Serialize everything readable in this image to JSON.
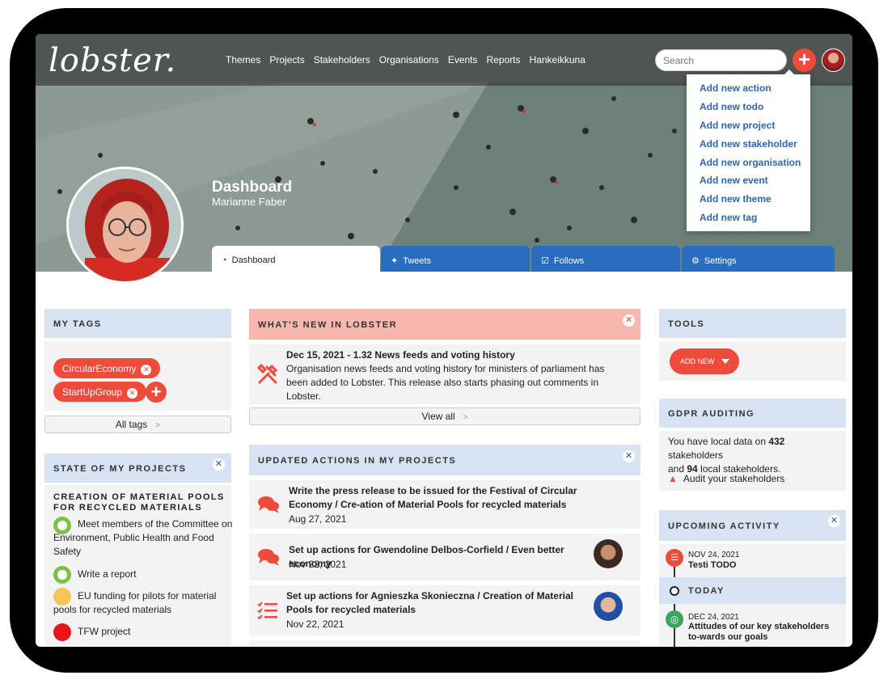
{
  "app": {
    "logo": "lobster."
  },
  "nav": [
    "Themes",
    "Projects",
    "Stakeholders",
    "Organisations",
    "Events",
    "Reports",
    "Hankeikkuna"
  ],
  "search": {
    "placeholder": "Search"
  },
  "add_menu": [
    "Add new action",
    "Add new todo",
    "Add new project",
    "Add new stakeholder",
    "Add new organisation",
    "Add new event",
    "Add new theme",
    "Add new tag"
  ],
  "hero": {
    "title": "Dashboard",
    "subtitle": "Marianne Faber"
  },
  "tabs": [
    {
      "label": "Dashboard",
      "icon": "gauge-icon"
    },
    {
      "label": "Tweets",
      "icon": "twitter-icon"
    },
    {
      "label": "Follows",
      "icon": "checkbox-icon"
    },
    {
      "label": "Settings",
      "icon": "gear-icon"
    }
  ],
  "my_tags": {
    "header": "MY TAGS",
    "tags": [
      "CircularEconomy",
      "StartUpGroup"
    ],
    "all_tags": "All tags"
  },
  "state_projects": {
    "header": "STATE OF MY PROJECTS",
    "project_title": "CREATION OF MATERIAL POOLS FOR RECYCLED MATERIALS",
    "items": [
      {
        "text": "Meet members of the Committee on Environment, Public Health and Food Safety",
        "status": "#7cc242"
      },
      {
        "text": "Write a report",
        "status": "#7cc242"
      },
      {
        "text": "EU funding for pilots for material pools for recycled materials",
        "status": "#f5c55a"
      },
      {
        "text": "TFW project",
        "status": "#e8141c"
      }
    ]
  },
  "whats_new": {
    "header": "WHAT'S NEW IN LOBSTER",
    "title": "Dec 15, 2021 - 1.32 News feeds and voting history",
    "body": "Organisation news feeds and voting history for ministers of parliament has been added to Lobster. This release also starts phasing out comments in Lobster.",
    "view_all": "View all"
  },
  "updated_actions": {
    "header": "UPDATED ACTIONS IN MY PROJECTS",
    "items": [
      {
        "title": "Write the press release to be issued for the Festival of Circular Economy / Cre-ation of Material Pools for recycled materials",
        "date": "Aug 27, 2021",
        "icon": "comments-icon"
      },
      {
        "title": "Set up actions for Gwendoline Delbos-Corfield / Even better economy",
        "date": "Nov 22, 2021",
        "icon": "comments-icon"
      },
      {
        "title": "Set up actions for Agnieszka Skonieczna / Creation of Material Pools for recycled materials",
        "date": "Nov 22, 2021",
        "icon": "checklist-icon"
      }
    ]
  },
  "tools": {
    "header": "TOOLS",
    "add_new": "ADD NEW"
  },
  "gdpr": {
    "header": "GDPR AUDITING",
    "line1_pre": "You have local data on ",
    "count1": "432",
    "line1_post": " stakeholders",
    "line2_pre": "and ",
    "count2": "94",
    "line2_post": " local stakeholders.",
    "audit": "Audit your stakeholders"
  },
  "upcoming": {
    "header": "UPCOMING ACTIVITY",
    "today": "TODAY",
    "items": [
      {
        "date": "NOV 24, 2021",
        "title": "Testi TODO"
      },
      {
        "date": "DEC 24, 2021",
        "title": "Attitudes of our key stakeholders to-wards our goals"
      }
    ]
  },
  "colors": {
    "accent": "#ef4b3c",
    "tab_blue": "#2a6dbf",
    "panel_header": "#d7e3f2",
    "link": "#2c66b5",
    "news_header": "#f6b8ae"
  }
}
